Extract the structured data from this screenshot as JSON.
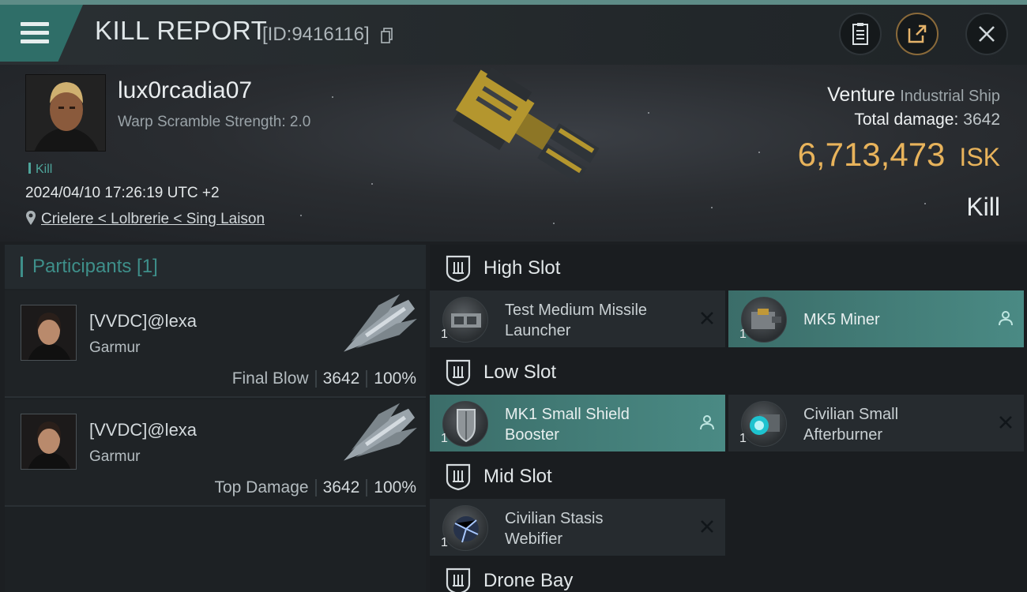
{
  "header": {
    "title": "KILL REPORT",
    "report_id": "[ID:9416116]",
    "icons": {
      "menu": "hamburger-icon",
      "copy": "copy-icon",
      "log": "clipboard-icon",
      "share": "share-icon",
      "close": "close-icon"
    }
  },
  "victim": {
    "pilot_name": "lux0rcadia07",
    "warp_scramble": "Warp Scramble Strength: 2.0",
    "kill_tag": "Kill",
    "datetime": "2024/04/10 17:26:19 UTC +2",
    "location": "Crielere < Lolbrerie < Sing Laison",
    "ship_name": "Venture",
    "ship_class": "Industrial Ship",
    "total_damage_label": "Total damage:",
    "total_damage": "3642",
    "isk_value": "6,713,473",
    "isk_unit": "ISK",
    "result": "Kill"
  },
  "participants": {
    "title": "Participants [1]",
    "rows": [
      {
        "name": "[VVDC]@lexa",
        "ship": "Garmur",
        "role": "Final Blow",
        "damage": "3642",
        "percent": "100%"
      },
      {
        "name": "[VVDC]@lexa",
        "ship": "Garmur",
        "role": "Top Damage",
        "damage": "3642",
        "percent": "100%"
      }
    ]
  },
  "slots": {
    "high": {
      "title": "High Slot",
      "modules": [
        {
          "name_line1": "Test Medium Missile",
          "name_line2": "Launcher",
          "qty": "1",
          "status": "destroyed"
        },
        {
          "name_line1": "MK5 Miner",
          "name_line2": "",
          "qty": "1",
          "status": "dropped"
        }
      ]
    },
    "low": {
      "title": "Low Slot",
      "modules": [
        {
          "name_line1": "MK1 Small Shield",
          "name_line2": "Booster",
          "qty": "1",
          "status": "dropped"
        },
        {
          "name_line1": "Civilian Small",
          "name_line2": "Afterburner",
          "qty": "1",
          "status": "destroyed"
        }
      ]
    },
    "mid": {
      "title": "Mid Slot",
      "modules": [
        {
          "name_line1": "Civilian Stasis",
          "name_line2": "Webifier",
          "qty": "1",
          "status": "destroyed"
        }
      ]
    },
    "drone": {
      "title": "Drone Bay"
    }
  },
  "colors": {
    "accent": "#3e8f8a",
    "isk": "#e8b35b",
    "active_module": "#4a8a84"
  }
}
